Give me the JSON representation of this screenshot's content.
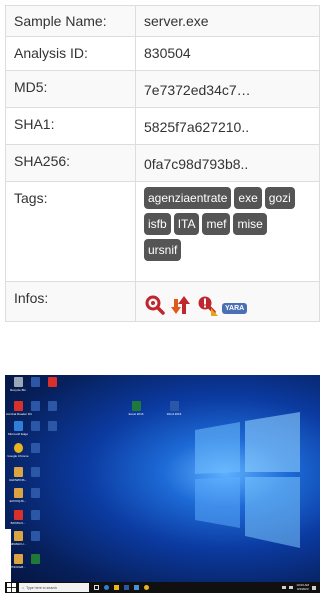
{
  "fields": [
    {
      "label": "Sample Name:",
      "value": "server.exe"
    },
    {
      "label": "Analysis ID:",
      "value": "830504"
    },
    {
      "label": "MD5:",
      "value": "7e7372ed34c7…"
    },
    {
      "label": "SHA1:",
      "value": "5825f7a627210.."
    },
    {
      "label": "SHA256:",
      "value": "0fa7c98d793b8.."
    }
  ],
  "tags_label": "Tags:",
  "tags": [
    "agenziaentrate",
    "exe",
    "gozi",
    "isfb",
    "ITA",
    "mef",
    "mise",
    "ursnif"
  ],
  "infos_label": "Infos:",
  "infos_icons": [
    "magnifier-icon",
    "arrows-up-down-icon",
    "alert-magnifier-icon",
    "yara-badge"
  ],
  "yara_label": "YARA",
  "screenshot": {
    "search_placeholder": "Type here to search",
    "clock_time": "10:03 AM",
    "clock_date": "3/4/2023",
    "desktop_icons": [
      {
        "label": "Recycle Bin",
        "color": "#9aa7b5"
      },
      {
        "label": "Acrobat Reader DC",
        "color": "#d9302c"
      },
      {
        "label": "Microsoft Edge",
        "color": "#2f7fd8"
      },
      {
        "label": "Google Chrome",
        "color": "#e8b521"
      },
      {
        "label": "UHDWKNS...",
        "color": "#d9a441"
      },
      {
        "label": "EOVXQJK...",
        "color": "#d9a441"
      },
      {
        "label": "BJXWLN...",
        "color": "#d9302c"
      },
      {
        "label": "MKMHCU...",
        "color": "#d9a441"
      },
      {
        "label": "PNCDGB...",
        "color": "#d9a441"
      }
    ],
    "mid_icons": [
      {
        "label": "Excel 2016",
        "color": "#1f7a3a"
      },
      {
        "label": "Word 2016",
        "color": "#2b57a6"
      }
    ]
  },
  "colors": {
    "tag_bg": "#555555",
    "row_alt": "#f9f9f9",
    "border": "#dddddd"
  }
}
